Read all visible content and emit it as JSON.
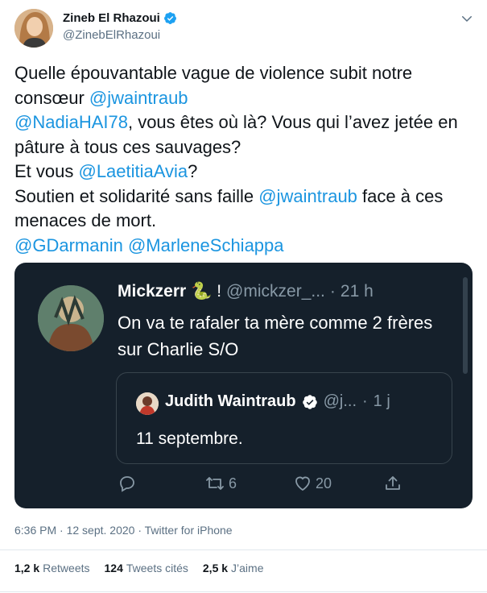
{
  "author": {
    "name": "Zineb El Rhazoui",
    "handle": "@ZinebElRhazoui"
  },
  "tweet": {
    "segments": [
      {
        "text": "Quelle épouvantable vague de violence subit notre consœur ",
        "mention": false
      },
      {
        "text": "@jwaintraub",
        "mention": true
      },
      {
        "text": "\n",
        "mention": false
      },
      {
        "text": "@NadiaHAI78",
        "mention": true
      },
      {
        "text": ", vous êtes où là? Vous qui l’avez jetée en pâture à tous ces sauvages?\nEt vous ",
        "mention": false
      },
      {
        "text": "@LaetitiaAvia",
        "mention": true
      },
      {
        "text": "?\nSoutien et solidarité sans faille ",
        "mention": false
      },
      {
        "text": "@jwaintraub",
        "mention": true
      },
      {
        "text": " face à ces menaces de mort.\n",
        "mention": false
      },
      {
        "text": "@GDarmanin",
        "mention": true
      },
      {
        "text": " ",
        "mention": false
      },
      {
        "text": "@MarleneSchiappa",
        "mention": true
      }
    ]
  },
  "embed": {
    "name": "Mickzerr",
    "emoji": "🐍 !",
    "handle": "@mickzer_...",
    "dot": "·",
    "time": "21 h",
    "body": "On va te rafaler ta mère comme 2 frères sur Charlie S/O",
    "quoted": {
      "name": "Judith Waintraub",
      "handle": "@j...",
      "dot": "·",
      "time": "1 j",
      "body": "11 septembre."
    },
    "actions": {
      "retweets": "6",
      "likes": "20"
    }
  },
  "meta": {
    "time": "6:36 PM",
    "sep1": "·",
    "date": "12 sept. 2020",
    "sep2": "·",
    "source": "Twitter for iPhone"
  },
  "stats": [
    {
      "value": "1,2 k",
      "label": "Retweets"
    },
    {
      "value": "124",
      "label": "Tweets cités"
    },
    {
      "value": "2,5 k",
      "label": "J’aime"
    }
  ],
  "colors": {
    "accent": "#1b95e0",
    "embed_bg": "#15202b",
    "secondary": "#5b7083"
  },
  "icons": [
    "verified-badge-icon",
    "chevron-down-icon",
    "reply-icon",
    "retweet-icon",
    "like-icon",
    "share-icon"
  ]
}
